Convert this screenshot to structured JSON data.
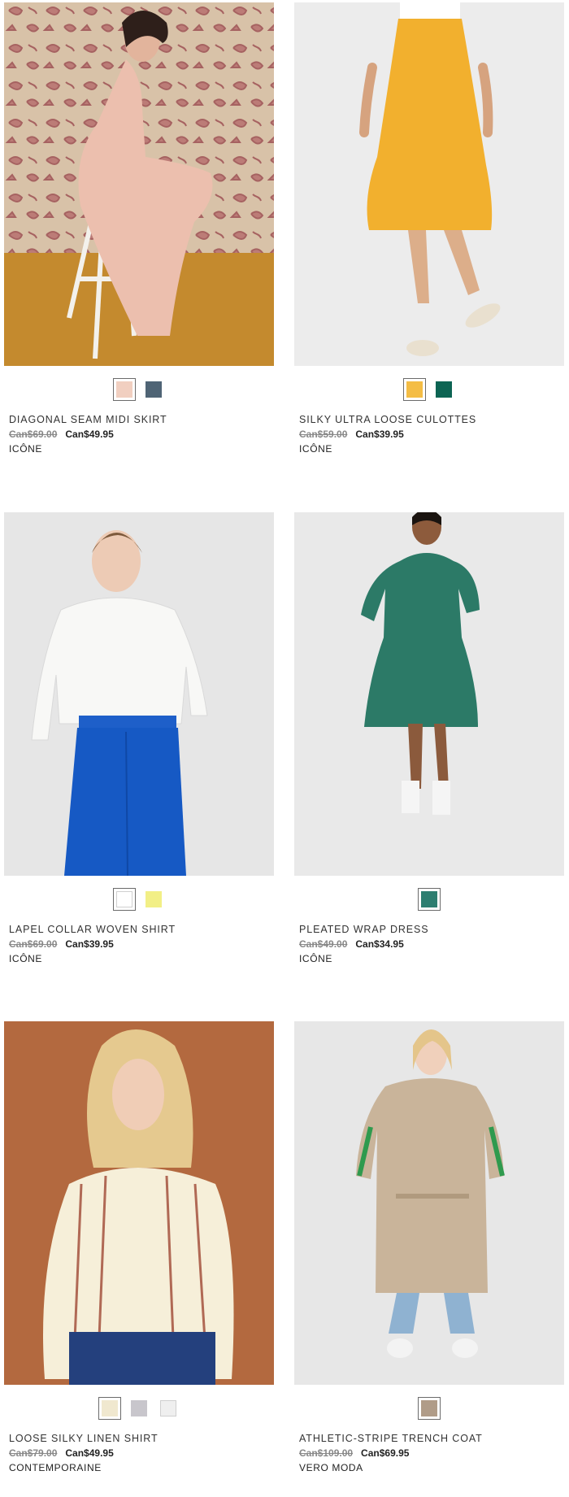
{
  "products": [
    {
      "name": "DIAGONAL SEAM MIDI SKIRT",
      "old_price": "Can$69.00",
      "new_price": "Can$49.95",
      "brand": "ICÔNE",
      "swatches": [
        "#f1cfc0",
        "#4f6475"
      ]
    },
    {
      "name": "SILKY ULTRA LOOSE CULOTTES",
      "old_price": "Can$59.00",
      "new_price": "Can$39.95",
      "brand": "ICÔNE",
      "swatches": [
        "#f4bd45",
        "#0d6453"
      ]
    },
    {
      "name": "LAPEL COLLAR WOVEN SHIRT",
      "old_price": "Can$69.00",
      "new_price": "Can$39.95",
      "brand": "ICÔNE",
      "swatches": [
        "#ffffff",
        "#f2ef86"
      ]
    },
    {
      "name": "PLEATED WRAP DRESS",
      "old_price": "Can$49.00",
      "new_price": "Can$34.95",
      "brand": "ICÔNE",
      "swatches": [
        "#2d7e70"
      ]
    },
    {
      "name": "LOOSE SILKY LINEN SHIRT",
      "old_price": "Can$79.00",
      "new_price": "Can$49.95",
      "brand": "CONTEMPORAINE",
      "swatches": [
        "#f0e8cf",
        "#c8c6cc",
        "#efefef"
      ]
    },
    {
      "name": "ATHLETIC-STRIPE TRENCH COAT",
      "old_price": "Can$109.00",
      "new_price": "Can$69.95",
      "brand": "VERO MODA",
      "swatches": [
        "#b09c88"
      ]
    }
  ]
}
